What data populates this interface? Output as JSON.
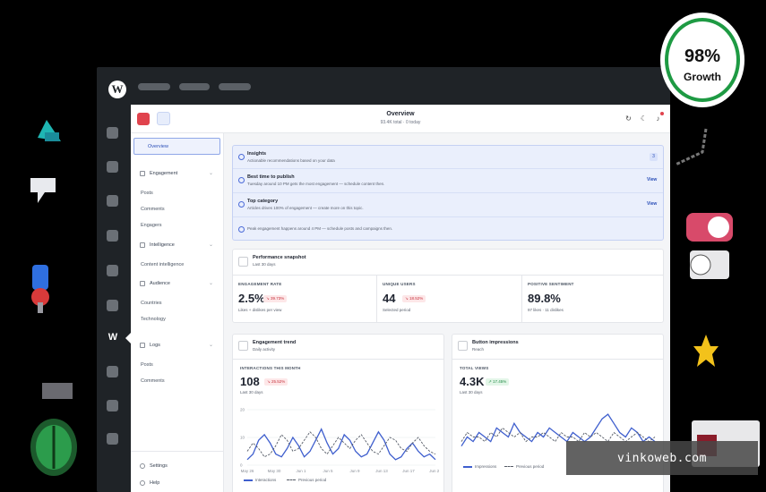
{
  "wp": {
    "logo": "W",
    "active_icon": "W"
  },
  "app": {
    "title": "Overview",
    "subtitle": "93.4K total · 0 today"
  },
  "sidebar": {
    "overview": "Overview",
    "engagement": "Engagement",
    "posts": "Posts",
    "comments": "Comments",
    "engagers": "Engagers",
    "intelligence": "Intelligence",
    "content_intelligence": "Content intelligence",
    "audience": "Audience",
    "countries": "Countries",
    "technology": "Technology",
    "logs": "Logs",
    "logs_posts": "Posts",
    "logs_comments": "Comments",
    "settings": "Settings",
    "help": "Help"
  },
  "insights": {
    "title": "Insights",
    "subtitle": "Actionable recommendations based on your data",
    "count": "3",
    "items": [
      {
        "title": "Best time to publish",
        "text": "Tuesday around 10 PM gets the most engagement — schedule content then.",
        "action": "View"
      },
      {
        "title": "Top category",
        "text": "Articles drives 100% of engagement — create more on this topic.",
        "action": "View"
      }
    ],
    "footer": "Peak engagement happens around 4 PM — schedule posts and campaigns then."
  },
  "snapshot": {
    "title": "Performance snapshot",
    "subtitle": "Last 30 days",
    "metrics": [
      {
        "label": "ENGAGEMENT RATE",
        "value": "2.5%",
        "change": "↘ 39.73%",
        "trend": "down",
        "note": "Likes + dislikes per view"
      },
      {
        "label": "UNIQUE USERS",
        "value": "44",
        "change": "↘ 18.52%",
        "trend": "down",
        "note": "Selected period"
      },
      {
        "label": "POSITIVE SENTIMENT",
        "value": "89.8%",
        "change": "",
        "trend": "none",
        "note": "97 likes · 11 dislikes"
      }
    ]
  },
  "trend_card": {
    "title": "Engagement trend",
    "subtitle": "Daily activity",
    "metric_label": "INTERACTIONS THIS MONTH",
    "value": "108",
    "change": "↘ 25.52%",
    "period": "Last 30 days",
    "legend": [
      "Interactions",
      "Previous period"
    ]
  },
  "impressions_card": {
    "title": "Button impressions",
    "subtitle": "Reach",
    "metric_label": "TOTAL VIEWS",
    "value": "4.3K",
    "change": "↗ 17.45%",
    "period": "Last 30 days",
    "legend": [
      "Impressions",
      "Previous period"
    ]
  },
  "chart_data": [
    {
      "type": "line",
      "title": "Engagement trend",
      "categories": [
        "May 26",
        "",
        "",
        "",
        "",
        "May 30",
        "",
        "",
        "",
        "",
        "Jun 1",
        "",
        "",
        "",
        "",
        "Jun 5",
        "",
        "",
        "",
        "",
        "Jun 9",
        "",
        "",
        "",
        "",
        "Jun 13",
        "",
        "",
        "",
        "",
        "Jun 17",
        "",
        "",
        "Jun 21"
      ],
      "x_ticks": [
        "May 26",
        "May 30",
        "Jun 1",
        "Jun 5",
        "Jun 9",
        "Jun 13",
        "Jun 17",
        "Jun 21"
      ],
      "y_ticks": [
        "20",
        "10",
        "0"
      ],
      "ylim": [
        0,
        20
      ],
      "series": [
        {
          "name": "Interactions",
          "values": [
            2,
            4,
            9,
            11,
            8,
            4,
            3,
            6,
            10,
            7,
            3,
            5,
            9,
            13,
            8,
            4,
            6,
            11,
            9,
            5,
            3,
            4,
            8,
            12,
            9,
            4,
            2,
            3,
            6,
            8,
            5,
            3,
            4,
            2
          ]
        },
        {
          "name": "Previous period",
          "values": [
            5,
            8,
            6,
            3,
            4,
            7,
            11,
            9,
            5,
            6,
            9,
            12,
            10,
            6,
            4,
            7,
            10,
            8,
            6,
            9,
            11,
            8,
            5,
            4,
            7,
            10,
            9,
            6,
            5,
            8,
            10,
            7,
            5,
            4
          ]
        }
      ],
      "colors": [
        "#3f5fce",
        "#555b66"
      ]
    },
    {
      "type": "line",
      "title": "Button impressions",
      "x_ticks": [],
      "y_ticks": [],
      "series": [
        {
          "name": "Impressions",
          "values": [
            3,
            5,
            4,
            6,
            5,
            4,
            7,
            6,
            5,
            8,
            6,
            5,
            4,
            6,
            5,
            7,
            6,
            5,
            4,
            6,
            5,
            4,
            5,
            7,
            9,
            10,
            8,
            6,
            5,
            7,
            6,
            4,
            5,
            4
          ]
        },
        {
          "name": "Previous period",
          "values": [
            4,
            6,
            5,
            5,
            4,
            6,
            5,
            7,
            6,
            5,
            6,
            4,
            5,
            5,
            6,
            5,
            4,
            6,
            5,
            5,
            4,
            6,
            5,
            6,
            5,
            4,
            6,
            5,
            4,
            5,
            6,
            5,
            4,
            5
          ]
        }
      ],
      "colors": [
        "#3f5fce",
        "#555b66"
      ]
    }
  ],
  "growth_badge": {
    "value": "98%",
    "label": "Growth"
  },
  "watermark": "vinkoweb.com",
  "colors": {
    "accent": "#3f5fce",
    "negative": "#c7323d",
    "positive": "#1f8a44",
    "brand": "#e0434d"
  }
}
